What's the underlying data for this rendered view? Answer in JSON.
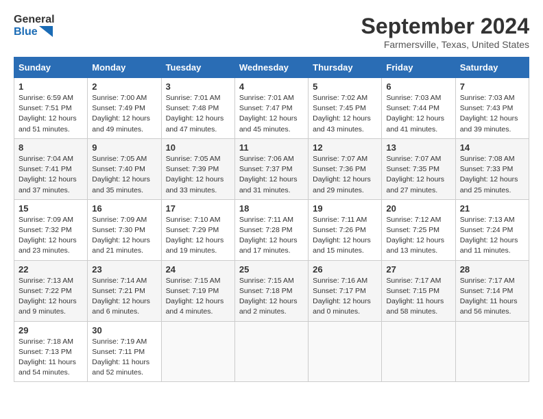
{
  "header": {
    "logo_line1": "General",
    "logo_line2": "Blue",
    "title": "September 2024",
    "location": "Farmersville, Texas, United States"
  },
  "columns": [
    "Sunday",
    "Monday",
    "Tuesday",
    "Wednesday",
    "Thursday",
    "Friday",
    "Saturday"
  ],
  "weeks": [
    [
      {
        "day": "1",
        "info": "Sunrise: 6:59 AM\nSunset: 7:51 PM\nDaylight: 12 hours\nand 51 minutes."
      },
      {
        "day": "2",
        "info": "Sunrise: 7:00 AM\nSunset: 7:49 PM\nDaylight: 12 hours\nand 49 minutes."
      },
      {
        "day": "3",
        "info": "Sunrise: 7:01 AM\nSunset: 7:48 PM\nDaylight: 12 hours\nand 47 minutes."
      },
      {
        "day": "4",
        "info": "Sunrise: 7:01 AM\nSunset: 7:47 PM\nDaylight: 12 hours\nand 45 minutes."
      },
      {
        "day": "5",
        "info": "Sunrise: 7:02 AM\nSunset: 7:45 PM\nDaylight: 12 hours\nand 43 minutes."
      },
      {
        "day": "6",
        "info": "Sunrise: 7:03 AM\nSunset: 7:44 PM\nDaylight: 12 hours\nand 41 minutes."
      },
      {
        "day": "7",
        "info": "Sunrise: 7:03 AM\nSunset: 7:43 PM\nDaylight: 12 hours\nand 39 minutes."
      }
    ],
    [
      {
        "day": "8",
        "info": "Sunrise: 7:04 AM\nSunset: 7:41 PM\nDaylight: 12 hours\nand 37 minutes."
      },
      {
        "day": "9",
        "info": "Sunrise: 7:05 AM\nSunset: 7:40 PM\nDaylight: 12 hours\nand 35 minutes."
      },
      {
        "day": "10",
        "info": "Sunrise: 7:05 AM\nSunset: 7:39 PM\nDaylight: 12 hours\nand 33 minutes."
      },
      {
        "day": "11",
        "info": "Sunrise: 7:06 AM\nSunset: 7:37 PM\nDaylight: 12 hours\nand 31 minutes."
      },
      {
        "day": "12",
        "info": "Sunrise: 7:07 AM\nSunset: 7:36 PM\nDaylight: 12 hours\nand 29 minutes."
      },
      {
        "day": "13",
        "info": "Sunrise: 7:07 AM\nSunset: 7:35 PM\nDaylight: 12 hours\nand 27 minutes."
      },
      {
        "day": "14",
        "info": "Sunrise: 7:08 AM\nSunset: 7:33 PM\nDaylight: 12 hours\nand 25 minutes."
      }
    ],
    [
      {
        "day": "15",
        "info": "Sunrise: 7:09 AM\nSunset: 7:32 PM\nDaylight: 12 hours\nand 23 minutes."
      },
      {
        "day": "16",
        "info": "Sunrise: 7:09 AM\nSunset: 7:30 PM\nDaylight: 12 hours\nand 21 minutes."
      },
      {
        "day": "17",
        "info": "Sunrise: 7:10 AM\nSunset: 7:29 PM\nDaylight: 12 hours\nand 19 minutes."
      },
      {
        "day": "18",
        "info": "Sunrise: 7:11 AM\nSunset: 7:28 PM\nDaylight: 12 hours\nand 17 minutes."
      },
      {
        "day": "19",
        "info": "Sunrise: 7:11 AM\nSunset: 7:26 PM\nDaylight: 12 hours\nand 15 minutes."
      },
      {
        "day": "20",
        "info": "Sunrise: 7:12 AM\nSunset: 7:25 PM\nDaylight: 12 hours\nand 13 minutes."
      },
      {
        "day": "21",
        "info": "Sunrise: 7:13 AM\nSunset: 7:24 PM\nDaylight: 12 hours\nand 11 minutes."
      }
    ],
    [
      {
        "day": "22",
        "info": "Sunrise: 7:13 AM\nSunset: 7:22 PM\nDaylight: 12 hours\nand 9 minutes."
      },
      {
        "day": "23",
        "info": "Sunrise: 7:14 AM\nSunset: 7:21 PM\nDaylight: 12 hours\nand 6 minutes."
      },
      {
        "day": "24",
        "info": "Sunrise: 7:15 AM\nSunset: 7:19 PM\nDaylight: 12 hours\nand 4 minutes."
      },
      {
        "day": "25",
        "info": "Sunrise: 7:15 AM\nSunset: 7:18 PM\nDaylight: 12 hours\nand 2 minutes."
      },
      {
        "day": "26",
        "info": "Sunrise: 7:16 AM\nSunset: 7:17 PM\nDaylight: 12 hours\nand 0 minutes."
      },
      {
        "day": "27",
        "info": "Sunrise: 7:17 AM\nSunset: 7:15 PM\nDaylight: 11 hours\nand 58 minutes."
      },
      {
        "day": "28",
        "info": "Sunrise: 7:17 AM\nSunset: 7:14 PM\nDaylight: 11 hours\nand 56 minutes."
      }
    ],
    [
      {
        "day": "29",
        "info": "Sunrise: 7:18 AM\nSunset: 7:13 PM\nDaylight: 11 hours\nand 54 minutes."
      },
      {
        "day": "30",
        "info": "Sunrise: 7:19 AM\nSunset: 7:11 PM\nDaylight: 11 hours\nand 52 minutes."
      },
      {
        "day": "",
        "info": ""
      },
      {
        "day": "",
        "info": ""
      },
      {
        "day": "",
        "info": ""
      },
      {
        "day": "",
        "info": ""
      },
      {
        "day": "",
        "info": ""
      }
    ]
  ]
}
